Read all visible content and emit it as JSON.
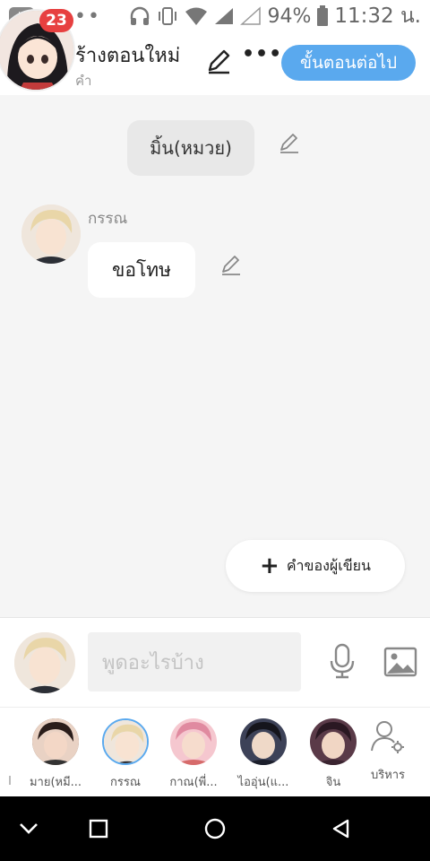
{
  "status_bar": {
    "battery": "94%",
    "time": "11:32 น.",
    "icons": [
      "youtube-icon",
      "more-dots-icon",
      "headphones-icon",
      "vibrate-icon",
      "wifi-icon",
      "signal-icon",
      "no-signal-icon",
      "battery-icon"
    ]
  },
  "header": {
    "badge_count": "23",
    "title": "ร้างตอนใหม่",
    "subtitle": "คำ",
    "next_button": "ขั้นตอนต่อไป",
    "accent": "#5aa9ee",
    "badge_color": "#e74040"
  },
  "chat": {
    "narration": "มิ้น(หมวย)",
    "message": {
      "sender": "กรรณ",
      "text": "ขอโทษ"
    },
    "author_button": "คำของผู้เขียน"
  },
  "input": {
    "placeholder": "พูดอะไรบ้าง"
  },
  "characters": [
    {
      "name": "มาย(หมี...",
      "color": "#6b4a3c"
    },
    {
      "name": "กรรณ",
      "color": "#e9dccd",
      "active": true
    },
    {
      "name": "กาณ(พี่...",
      "color": "#d66b6b"
    },
    {
      "name": "ไออุ่น(แ...",
      "color": "#2e3148"
    },
    {
      "name": "จิน",
      "color": "#4a2f3a"
    }
  ],
  "manage_label": "บริหาร"
}
